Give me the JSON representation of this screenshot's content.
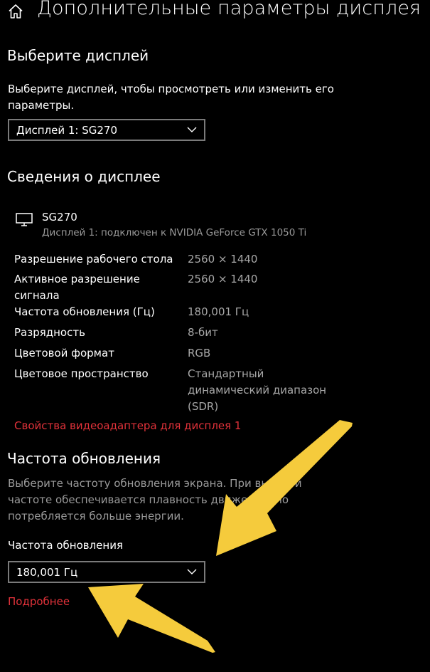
{
  "header": {
    "title": "Дополнительные параметры дисплея",
    "home_icon": "home-icon"
  },
  "select_display": {
    "heading": "Выберите дисплей",
    "description": "Выберите дисплей, чтобы просмотреть или изменить его параметры.",
    "dropdown_value": "Дисплей 1: SG270"
  },
  "display_info": {
    "heading": "Сведения о дисплее",
    "monitor_icon": "monitor-icon",
    "monitor_name": "SG270",
    "monitor_subtitle": "Дисплей 1: подключен к NVIDIA GeForce GTX 1050 Ti",
    "rows": [
      {
        "label": "Разрешение рабочего стола",
        "value": "2560 × 1440"
      },
      {
        "label": "Активное разрешение сигнала",
        "value": "2560 × 1440"
      },
      {
        "label": "Частота обновления (Гц)",
        "value": "180,001 Гц"
      },
      {
        "label": "Разрядность",
        "value": "8-бит"
      },
      {
        "label": "Цветовой формат",
        "value": "RGB"
      },
      {
        "label": "Цветовое пространство",
        "value": "Стандартный динамический диапазон (SDR)"
      }
    ],
    "adapter_link": "Свойства видеоадаптера для дисплея 1"
  },
  "refresh_rate": {
    "heading": "Частота обновления",
    "description": "Выберите частоту обновления экрана. При высокой частоте обеспечивается плавность движений, но потребляется больше энергии.",
    "field_label": "Частота обновления",
    "dropdown_value": "180,001 Гц",
    "more_link": "Подробнее"
  },
  "overlay": {
    "arrow_color": "#f5cb3c"
  }
}
